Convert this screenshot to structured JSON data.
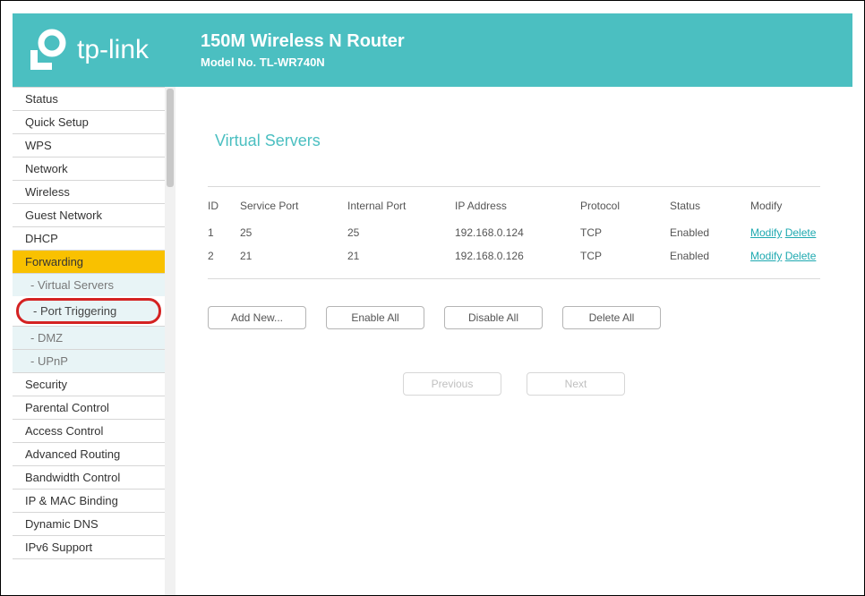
{
  "header": {
    "brand": "tp-link",
    "title": "150M Wireless N Router",
    "model": "Model No. TL-WR740N"
  },
  "sidebar": {
    "items": [
      {
        "label": "Status",
        "kind": "item"
      },
      {
        "label": "Quick Setup",
        "kind": "item"
      },
      {
        "label": "WPS",
        "kind": "item"
      },
      {
        "label": "Network",
        "kind": "item"
      },
      {
        "label": "Wireless",
        "kind": "item"
      },
      {
        "label": "Guest Network",
        "kind": "item"
      },
      {
        "label": "DHCP",
        "kind": "item"
      },
      {
        "label": "Forwarding",
        "kind": "active"
      },
      {
        "label": "- Virtual Servers",
        "kind": "sub"
      },
      {
        "label": "- Port Triggering",
        "kind": "sub-highlight"
      },
      {
        "label": "- DMZ",
        "kind": "sub"
      },
      {
        "label": "- UPnP",
        "kind": "sub"
      },
      {
        "label": "Security",
        "kind": "item"
      },
      {
        "label": "Parental Control",
        "kind": "item"
      },
      {
        "label": "Access Control",
        "kind": "item"
      },
      {
        "label": "Advanced Routing",
        "kind": "item"
      },
      {
        "label": "Bandwidth Control",
        "kind": "item"
      },
      {
        "label": "IP & MAC Binding",
        "kind": "item"
      },
      {
        "label": "Dynamic DNS",
        "kind": "item"
      },
      {
        "label": "IPv6 Support",
        "kind": "item"
      }
    ]
  },
  "page": {
    "title": "Virtual Servers",
    "columns": {
      "id": "ID",
      "service": "Service Port",
      "internal": "Internal Port",
      "ip": "IP Address",
      "proto": "Protocol",
      "status": "Status",
      "modify": "Modify"
    },
    "rows": [
      {
        "id": "1",
        "service": "25",
        "internal": "25",
        "ip": "192.168.0.124",
        "proto": "TCP",
        "status": "Enabled",
        "mod": "Modify",
        "del": "Delete"
      },
      {
        "id": "2",
        "service": "21",
        "internal": "21",
        "ip": "192.168.0.126",
        "proto": "TCP",
        "status": "Enabled",
        "mod": "Modify",
        "del": "Delete"
      }
    ],
    "buttons": {
      "add": "Add New...",
      "enable": "Enable All",
      "disable": "Disable All",
      "delete": "Delete All",
      "prev": "Previous",
      "next": "Next"
    }
  }
}
